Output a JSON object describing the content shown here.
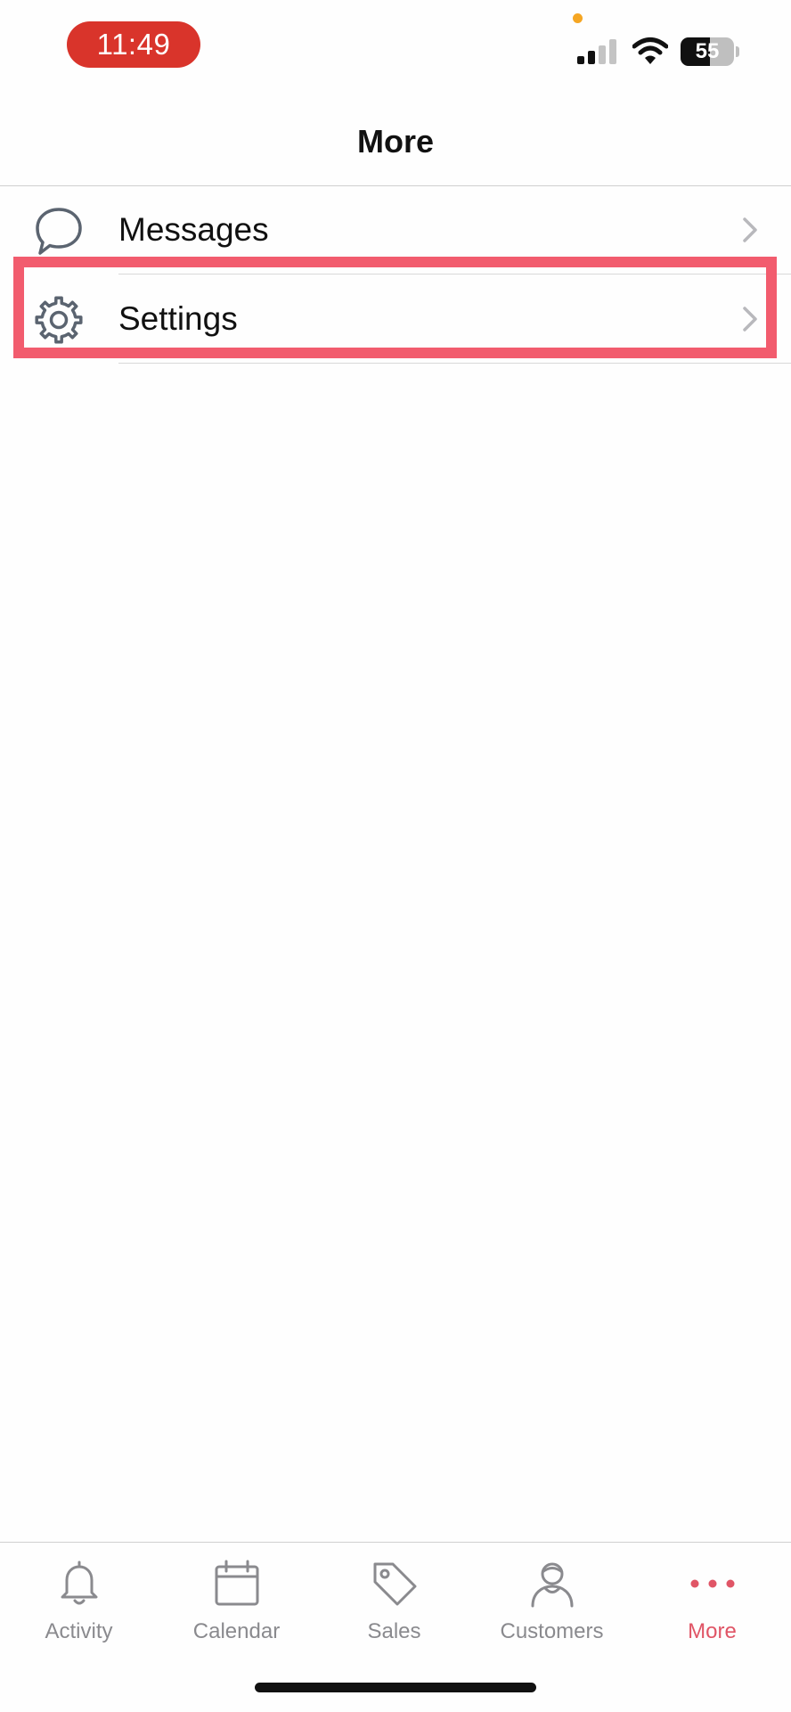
{
  "status_bar": {
    "time": "11:49",
    "battery_level": "55",
    "battery_percent": 55,
    "signal_bars_active": 2,
    "signal_bars_total": 4,
    "time_pill_color": "#d9342b",
    "privacy_dot_color": "#f5a623"
  },
  "nav": {
    "title": "More"
  },
  "menu": {
    "items": [
      {
        "label": "Messages",
        "icon": "speech-bubble-icon"
      },
      {
        "label": "Settings",
        "icon": "gear-icon",
        "highlighted": true
      }
    ]
  },
  "highlight_color": "#f25c6e",
  "tab_bar": {
    "active_color": "#e05566",
    "inactive_color": "#8a8a8e",
    "tabs": [
      {
        "label": "Activity",
        "icon": "bell-icon"
      },
      {
        "label": "Calendar",
        "icon": "calendar-icon"
      },
      {
        "label": "Sales",
        "icon": "tag-icon"
      },
      {
        "label": "Customers",
        "icon": "person-icon"
      },
      {
        "label": "More",
        "icon": "more-dots-icon",
        "active": true
      }
    ]
  }
}
